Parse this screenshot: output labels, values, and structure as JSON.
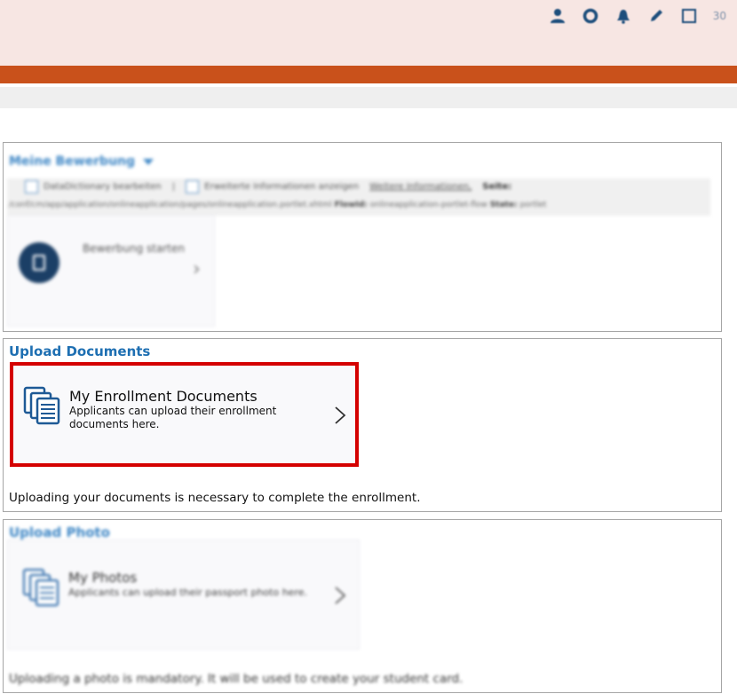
{
  "header": {
    "count_badge": "30",
    "icons": [
      "user-icon",
      "gear-icon",
      "bell-icon",
      "pencil-icon",
      "square-icon"
    ]
  },
  "colors": {
    "header_bg": "#f7e6e3",
    "accent_bar": "#c9511b",
    "link_blue": "#1e6fb2",
    "highlight_red": "#d40000",
    "circle_navy": "#1b3f66"
  },
  "application_panel": {
    "title": "Meine Bewerbung",
    "dev_checkbox1_label": "DataDictionary bearbeiten",
    "separator": "|",
    "dev_checkbox2_label": "Erweiterte Informationen anzeigen",
    "more_info_link": "Weitere Informationen,",
    "page_label": "Seite:",
    "path": "/conf/cm/app/application/onlineapplication/pages/onlineapplication.portlet.xhtml",
    "flowid_label": "FlowId:",
    "flowid_value": "onlineapplication-portlet-flow",
    "state_label": "State:",
    "state_value": "portlet",
    "start_tile_label": "Bewerbung starten"
  },
  "upload_documents_panel": {
    "title": "Upload Documents",
    "tile_title": "My Enrollment Documents",
    "tile_description": "Applicants can upload their enrollment documents here.",
    "footer": "Uploading your documents is necessary to complete the enrollment."
  },
  "upload_photo_panel": {
    "title": "Upload Photo",
    "tile_title": "My Photos",
    "tile_description": "Applicants can upload their passport photo here.",
    "footer": "Uploading a photo is mandatory. It will be used to create your student card."
  }
}
